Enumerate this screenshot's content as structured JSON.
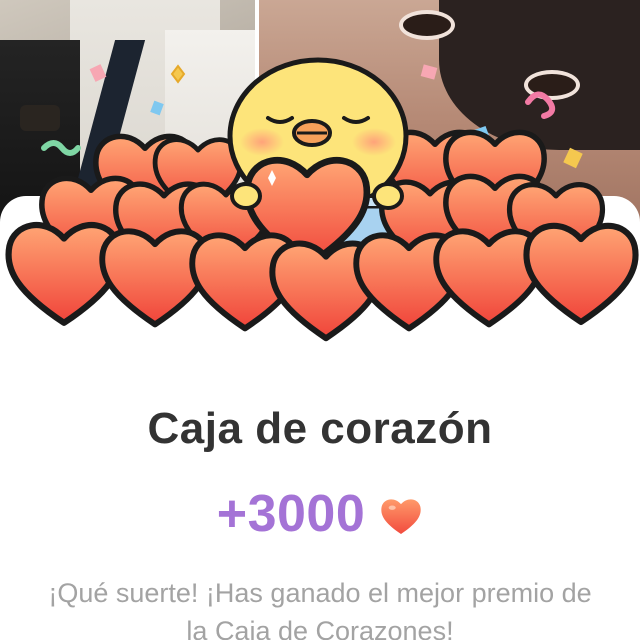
{
  "reward_card": {
    "title": "Caja de corazón",
    "amount": "+3000",
    "reward_icon": "heart-icon",
    "message": "¡Qué suerte! ¡Has ganado el mejor premio de la Caja de Corazones!"
  },
  "colors": {
    "amount": "#a473d6",
    "title": "#333333",
    "message": "#a3a3a3",
    "heart_top": "#ff9a6a",
    "heart_bottom": "#f24b3e",
    "chick": "#fde47a",
    "box": "#a8d2f0"
  },
  "illustration": {
    "character": "yellow-chick-holding-heart",
    "container": "heart-box"
  }
}
